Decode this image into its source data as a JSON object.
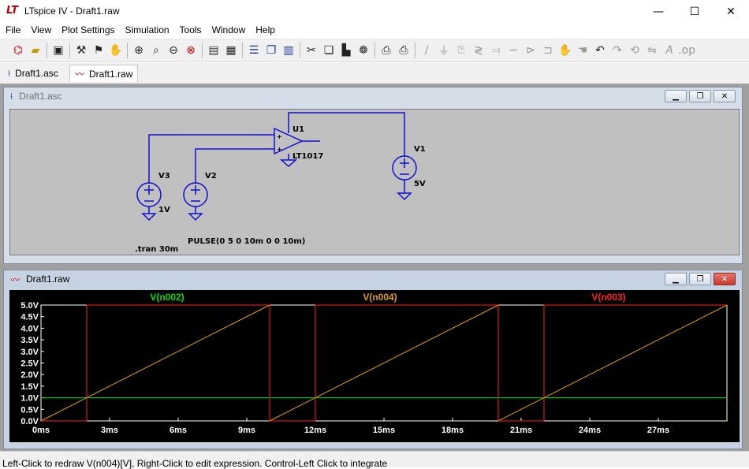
{
  "window": {
    "logo": "LT",
    "title": "LTspice IV - Draft1.raw",
    "minimize": "—",
    "maximize": "☐",
    "close": "✕"
  },
  "menu": [
    "File",
    "View",
    "Plot Settings",
    "Simulation",
    "Tools",
    "Window",
    "Help"
  ],
  "toolbar": {
    "icons": [
      "new-schematic",
      "open",
      "save",
      "control-panel",
      "run",
      "halt",
      "zoom-in",
      "pan",
      "zoom-out",
      "zoom-fit",
      "autorange",
      "grid",
      "tile-horizontal",
      "cascade",
      "tile-vertical",
      "cut",
      "copy",
      "paste",
      "find",
      "print-preview",
      "print",
      "wire",
      "ground",
      "label",
      "resistor",
      "capacitor",
      "inductor",
      "diode",
      "component",
      "move",
      "drag",
      "undo",
      "redo",
      "rotate",
      "mirror",
      "text",
      "spice-directive"
    ]
  },
  "tabs": [
    {
      "label": "Draft1.asc",
      "icon": "schematic-icon"
    },
    {
      "label": "Draft1.raw",
      "icon": "waveform-icon",
      "active": true
    }
  ],
  "schematic_window": {
    "title": "Draft1.asc",
    "components": {
      "v3_name": "V3",
      "v3_value": "1V",
      "v2_name": "V2",
      "v2_value": "PULSE(0 5 0 10m 0 0 10m)",
      "u1_name": "U1",
      "u1_value": "LT1017",
      "v1_name": "V1",
      "v1_value": "5V",
      "directive": ".tran 30m"
    }
  },
  "plot_window": {
    "title": "Draft1.raw",
    "status": "Left-Click to redraw V(n004)[V],  Right-Click to edit expression. Control-Left Click to integrate"
  },
  "chart_data": {
    "type": "line",
    "xlabel": "",
    "ylabel": "",
    "xlim": [
      0,
      30
    ],
    "ylim": [
      0,
      5
    ],
    "x_unit": "ms",
    "y_unit": "V",
    "x_ticks": [
      "0ms",
      "3ms",
      "6ms",
      "9ms",
      "12ms",
      "15ms",
      "18ms",
      "21ms",
      "24ms",
      "27ms"
    ],
    "y_ticks": [
      "0.0V",
      "0.5V",
      "1.0V",
      "1.5V",
      "2.0V",
      "2.5V",
      "3.0V",
      "3.5V",
      "4.0V",
      "4.5V",
      "5.0V"
    ],
    "grid": false,
    "series": [
      {
        "name": "V(n002)",
        "color": "#00e000",
        "x": [
          0,
          30
        ],
        "y": [
          1.0,
          1.0
        ]
      },
      {
        "name": "V(n004)",
        "color": "#e0a000",
        "x": [
          0,
          10,
          10,
          20,
          20,
          30
        ],
        "y": [
          0,
          5,
          0,
          5,
          0,
          5
        ]
      },
      {
        "name": "V(n003)",
        "color": "#ff2020",
        "x": [
          0,
          2,
          2,
          10,
          10,
          12,
          12,
          20,
          20,
          22,
          22,
          30
        ],
        "y": [
          0,
          0,
          5,
          5,
          0,
          0,
          5,
          5,
          0,
          0,
          5,
          5
        ]
      }
    ]
  }
}
